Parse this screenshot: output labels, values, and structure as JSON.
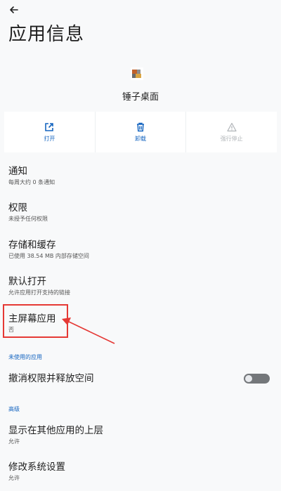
{
  "header": {
    "title": "应用信息"
  },
  "app": {
    "name": "锤子桌面"
  },
  "actions": [
    {
      "label": "打开",
      "icon": "open-external-icon",
      "enabled": true
    },
    {
      "label": "卸载",
      "icon": "trash-icon",
      "enabled": true
    },
    {
      "label": "强行停止",
      "icon": "warning-icon",
      "enabled": false
    }
  ],
  "settings": [
    {
      "title": "通知",
      "subtitle": "每周大约 0 条通知"
    },
    {
      "title": "权限",
      "subtitle": "未授予任何权限"
    },
    {
      "title": "存储和缓存",
      "subtitle": "已使用 38.54 MB 内部存储空间"
    },
    {
      "title": "默认打开",
      "subtitle": "允许应用打开支持的链接"
    },
    {
      "title": "主屏幕应用",
      "subtitle": "否"
    }
  ],
  "unused_section": {
    "label": "未使用的应用",
    "item": "撤消权限并释放空间",
    "toggle_on": false
  },
  "advanced_section": {
    "label": "高级",
    "items": [
      {
        "title": "显示在其他应用的上层",
        "subtitle": "允许"
      },
      {
        "title": "修改系统设置",
        "subtitle": "允许"
      }
    ]
  },
  "colors": {
    "accent": "#1565c0",
    "annotation": "#e53935"
  }
}
